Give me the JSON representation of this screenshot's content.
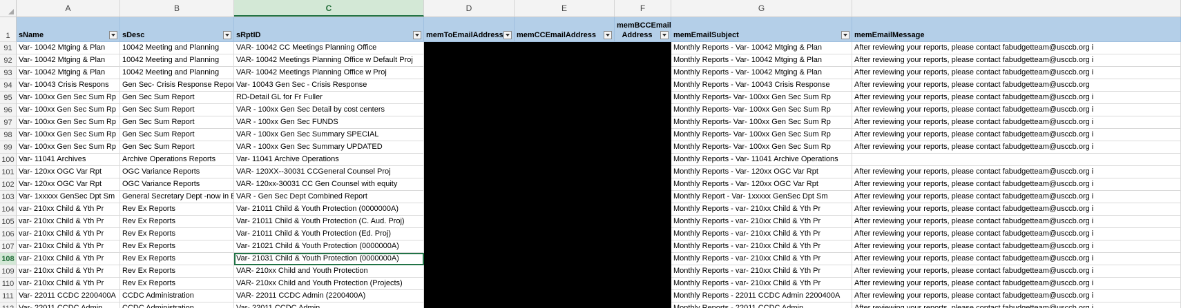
{
  "columns": [
    "A",
    "B",
    "C",
    "D",
    "E",
    "F",
    "G",
    ""
  ],
  "header_row_number": "1",
  "headers": [
    "sName",
    "sDesc",
    "sRptID",
    "memToEmailAddress",
    "memCCEmailAddress",
    "memBCCEmail Address",
    "memEmailSubject",
    "memEmailMessage"
  ],
  "rows": [
    {
      "n": "91",
      "a": "Var- 10042 Mtging & Plan",
      "b": "10042 Meeting and Planning",
      "c": "VAR- 10042 CC Meetings Planning Office",
      "g": "Monthly Reports - Var- 10042 Mtging & Plan",
      "h": "After reviewing your reports, please contact fabudgetteam@usccb.org i"
    },
    {
      "n": "92",
      "a": "Var- 10042 Mtging & Plan",
      "b": "10042 Meeting and Planning",
      "c": "VAR- 10042 Meetings Planning Office w Default Proj",
      "g": "Monthly Reports - Var- 10042 Mtging & Plan",
      "h": "After reviewing your reports, please contact fabudgetteam@usccb.org i"
    },
    {
      "n": "93",
      "a": "Var- 10042 Mtging & Plan",
      "b": "10042 Meeting and Planning",
      "c": "VAR- 10042 Meetings Planning Office w Proj",
      "g": "Monthly Reports - Var- 10042 Mtging & Plan",
      "h": "After reviewing your reports, please contact fabudgetteam@usccb.org i"
    },
    {
      "n": "94",
      "a": "Var- 10043 Crisis Respons",
      "b": "Gen Sec- Crisis Response Report",
      "c": "Var- 10043 Gen Sec - Crisis Response",
      "g": "Monthly Reports - Var- 10043 Crisis Response",
      "h": "After reviewing your reports, please contact fabudgetteam@usccb.org"
    },
    {
      "n": "95",
      "a": "Var- 100xx Gen Sec Sum Rp",
      "b": "Gen Sec Sum Report",
      "c": "RD-Detail GL for Fr Fuller",
      "g": "Monthly Reports- Var- 100xx Gen Sec Sum Rp",
      "h": "After reviewing your reports, please contact fabudgetteam@usccb.org i"
    },
    {
      "n": "96",
      "a": "Var- 100xx Gen Sec Sum Rp",
      "b": "Gen Sec Sum Report",
      "c": "VAR - 100xx Gen Sec Detail by cost centers",
      "g": "Monthly Reports- Var- 100xx Gen Sec Sum Rp",
      "h": "After reviewing your reports, please contact fabudgetteam@usccb.org i"
    },
    {
      "n": "97",
      "a": "Var- 100xx Gen Sec Sum Rp",
      "b": "Gen Sec Sum Report",
      "c": "VAR - 100xx Gen Sec FUNDS",
      "g": "Monthly Reports- Var- 100xx Gen Sec Sum Rp",
      "h": "After reviewing your reports, please contact fabudgetteam@usccb.org i"
    },
    {
      "n": "98",
      "a": "Var- 100xx Gen Sec Sum Rp",
      "b": "Gen Sec Sum Report",
      "c": "VAR - 100xx Gen Sec Summary SPECIAL",
      "g": "Monthly Reports- Var- 100xx Gen Sec Sum Rp",
      "h": "After reviewing your reports, please contact fabudgetteam@usccb.org i"
    },
    {
      "n": "99",
      "a": "Var- 100xx Gen Sec Sum Rp",
      "b": "Gen Sec Sum Report",
      "c": "VAR - 100xx Gen Sec Summary UPDATED",
      "g": "Monthly Reports- Var- 100xx Gen Sec Sum Rp",
      "h": "After reviewing your reports, please contact fabudgetteam@usccb.org i"
    },
    {
      "n": "100",
      "a": "Var- 11041 Archives",
      "b": "Archive Operations Reports",
      "c": "Var- 11041 Archive Operations",
      "g": "Monthly Reports - Var- 11041 Archive Operations",
      "h": ""
    },
    {
      "n": "101",
      "a": "Var- 120xx OGC Var Rpt",
      "b": "OGC Variance Reports",
      "c": "VAR- 120XX--30031  CCGeneral Counsel Proj",
      "g": "Monthly Reports - Var- 120xx OGC Var Rpt",
      "h": "After reviewing your reports, please contact fabudgetteam@usccb.org i"
    },
    {
      "n": "102",
      "a": "Var- 120xx OGC Var Rpt",
      "b": "OGC Variance Reports",
      "c": "VAR- 120xx-30031 CC Gen Counsel with equity",
      "g": "Monthly Reports - Var- 120xx OGC Var Rpt",
      "h": "After reviewing your reports, please contact fabudgetteam@usccb.org i"
    },
    {
      "n": "103",
      "a": "Var- 1xxxxx GenSec Dpt Sm",
      "b": "General Secretary Dept  -now in EX",
      "c": "VAR - Gen Sec Dept Combined Report",
      "g": "Monthly Report - Var- 1xxxxx GenSec Dpt Sm",
      "h": "After reviewing your reports, please contact fabudgetteam@usccb.org i"
    },
    {
      "n": "104",
      "a": "var- 210xx Child & Yth Pr",
      "b": "Rev Ex Reports",
      "c": "Var- 21011 Child & Youth Protection (0000000A)",
      "g": "Monthly Reports - var- 210xx Child & Yth Pr",
      "h": "After reviewing your reports, please contact fabudgetteam@usccb.org i"
    },
    {
      "n": "105",
      "a": "var- 210xx Child & Yth Pr",
      "b": "Rev Ex Reports",
      "c": "Var- 21011 Child & Youth Protection (C. Aud. Proj)",
      "g": "Monthly Reports - var- 210xx Child & Yth Pr",
      "h": "After reviewing your reports, please contact fabudgetteam@usccb.org i"
    },
    {
      "n": "106",
      "a": "var- 210xx Child & Yth Pr",
      "b": "Rev Ex Reports",
      "c": "Var- 21011 Child & Youth Protection (Ed. Proj)",
      "g": "Monthly Reports - var- 210xx Child & Yth Pr",
      "h": "After reviewing your reports, please contact fabudgetteam@usccb.org i"
    },
    {
      "n": "107",
      "a": "var- 210xx Child & Yth Pr",
      "b": "Rev Ex Reports",
      "c": "Var- 21021 Child & Youth Protection (0000000A)",
      "g": "Monthly Reports - var- 210xx Child & Yth Pr",
      "h": "After reviewing your reports, please contact fabudgetteam@usccb.org i"
    },
    {
      "n": "108",
      "a": "var- 210xx Child & Yth Pr",
      "b": "Rev Ex Reports",
      "c": "Var- 21031 Child & Youth Protection (0000000A)",
      "g": "Monthly Reports - var- 210xx Child & Yth Pr",
      "h": "After reviewing your reports, please contact fabudgetteam@usccb.org i"
    },
    {
      "n": "109",
      "a": "var- 210xx Child & Yth Pr",
      "b": "Rev Ex Reports",
      "c": "VAR- 210xx Child and Youth Protection",
      "g": "Monthly Reports - var- 210xx Child & Yth Pr",
      "h": "After reviewing your reports, please contact fabudgetteam@usccb.org i"
    },
    {
      "n": "110",
      "a": "var- 210xx Child & Yth Pr",
      "b": "Rev Ex Reports",
      "c": "VAR- 210xx Child and Youth Protection (Projects)",
      "g": "Monthly Reports - var- 210xx Child & Yth Pr",
      "h": "After reviewing your reports, please contact fabudgetteam@usccb.org i"
    },
    {
      "n": "111",
      "a": "Var- 22011 CCDC 2200400A",
      "b": "CCDC Administration",
      "c": "VAR- 22011 CCDC Admin (2200400A)",
      "g": "Monthly Reports -  22011 CCDC Admin 2200400A",
      "h": "After reviewing your reports, please contact fabudgetteam@usccb.org i"
    },
    {
      "n": "112",
      "a": "Var- 22011 CCDC Admin",
      "b": "CCDC Administration",
      "c": "Var- 22011 CCDC Admin",
      "g": "Monthly Reports - 22011 CCDC Admin",
      "h": "After reviewing your reports, please contact fabudgetteam@usccb.org i"
    }
  ],
  "selection": {
    "column": "C",
    "row": "108"
  },
  "colors": {
    "header_fill": "#b4cfe8",
    "selection": "#217346",
    "redacted": "#000000"
  }
}
